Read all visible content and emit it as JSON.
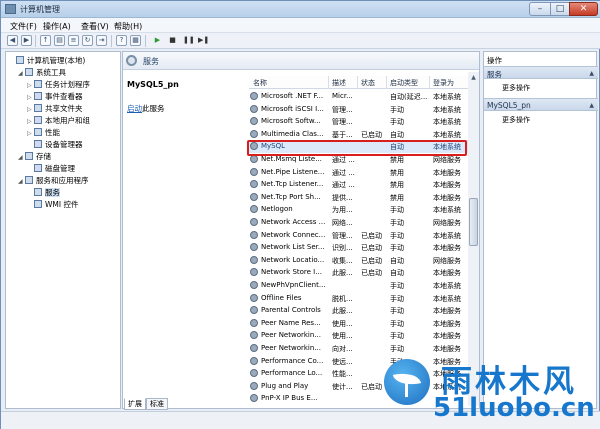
{
  "window": {
    "title": "计算机管理"
  },
  "window_controls": {
    "minimize": "–",
    "maximize": "□",
    "close": "✕"
  },
  "menu": [
    "文件(F)",
    "操作(A)",
    "查看(V)",
    "帮助(H)"
  ],
  "tree": [
    {
      "label": "计算机管理(本地)",
      "exp": "",
      "level": 0,
      "icon": "computer-icon"
    },
    {
      "label": "系统工具",
      "exp": "◢",
      "level": 1,
      "icon": "tools-icon"
    },
    {
      "label": "任务计划程序",
      "exp": "▷",
      "level": 2,
      "icon": "task-scheduler-icon"
    },
    {
      "label": "事件查看器",
      "exp": "▷",
      "level": 2,
      "icon": "event-viewer-icon"
    },
    {
      "label": "共享文件夹",
      "exp": "▷",
      "level": 2,
      "icon": "shared-folder-icon"
    },
    {
      "label": "本地用户和组",
      "exp": "▷",
      "level": 2,
      "icon": "users-icon"
    },
    {
      "label": "性能",
      "exp": "▷",
      "level": 2,
      "icon": "performance-icon"
    },
    {
      "label": "设备管理器",
      "exp": "",
      "level": 2,
      "icon": "device-manager-icon"
    },
    {
      "label": "存储",
      "exp": "◢",
      "level": 1,
      "icon": "storage-icon"
    },
    {
      "label": "磁盘管理",
      "exp": "",
      "level": 2,
      "icon": "disk-icon"
    },
    {
      "label": "服务和应用程序",
      "exp": "◢",
      "level": 1,
      "icon": "services-apps-icon"
    },
    {
      "label": "服务",
      "exp": "",
      "level": 2,
      "icon": "services-icon",
      "selected": true
    },
    {
      "label": "WMI 控件",
      "exp": "",
      "level": 2,
      "icon": "wmi-icon"
    }
  ],
  "middle": {
    "header": "服务",
    "selected_service": "MySQL5_pn",
    "start_link": "启动",
    "start_suffix": "此服务"
  },
  "table": {
    "columns": [
      "名称",
      "描述",
      "状态",
      "启动类型",
      "登录为"
    ],
    "rows": [
      [
        "Microsoft .NET F...",
        "Micr...",
        "",
        "自动(延迟...",
        "本地系统"
      ],
      [
        "Microsoft iSCSI I...",
        "管理...",
        "",
        "手动",
        "本地系统"
      ],
      [
        "Microsoft Softw...",
        "管理...",
        "",
        "手动",
        "本地系统"
      ],
      [
        "Multimedia Clas...",
        "基于...",
        "已启动",
        "自动",
        "本地系统"
      ],
      [
        "MySQL",
        "",
        "",
        "自动",
        "本地系统"
      ],
      [
        "Net.Msmq Liste...",
        "通过 ...",
        "",
        "禁用",
        "网络服务"
      ],
      [
        "Net.Pipe Listene...",
        "通过 ...",
        "",
        "禁用",
        "本地服务"
      ],
      [
        "Net.Tcp Listener...",
        "通过 ...",
        "",
        "禁用",
        "本地服务"
      ],
      [
        "Net.Tcp Port Sh...",
        "提供...",
        "",
        "禁用",
        "本地服务"
      ],
      [
        "Netlogon",
        "为用...",
        "",
        "手动",
        "本地系统"
      ],
      [
        "Network Access ...",
        "网络...",
        "",
        "手动",
        "网络服务"
      ],
      [
        "Network Connec...",
        "管理...",
        "已启动",
        "手动",
        "本地系统"
      ],
      [
        "Network List Ser...",
        "识别...",
        "已启动",
        "手动",
        "本地服务"
      ],
      [
        "Network Locatio...",
        "收集...",
        "已启动",
        "自动",
        "网络服务"
      ],
      [
        "Network Store I...",
        "此服...",
        "已启动",
        "自动",
        "本地服务"
      ],
      [
        "NewPhVpnClient...",
        "",
        "",
        "手动",
        "本地系统"
      ],
      [
        "Offline Files",
        "脱机...",
        "",
        "手动",
        "本地系统"
      ],
      [
        "Parental Controls",
        "此服...",
        "",
        "手动",
        "本地服务"
      ],
      [
        "Peer Name Res...",
        "使用...",
        "",
        "手动",
        "本地服务"
      ],
      [
        "Peer Networkin...",
        "使用...",
        "",
        "手动",
        "本地服务"
      ],
      [
        "Peer Networkin...",
        "向对...",
        "",
        "手动",
        "本地服务"
      ],
      [
        "Performance Co...",
        "使远...",
        "",
        "手动",
        "本地服务"
      ],
      [
        "Performance Lo...",
        "性能...",
        "",
        "手动",
        "本地服务"
      ],
      [
        "Plug and Play",
        "使计...",
        "已启动",
        "自动",
        "本地系统"
      ],
      [
        "PnP-X IP Bus E...",
        "",
        "",
        "",
        ""
      ]
    ],
    "selected_index": 4
  },
  "tabs": [
    "扩展",
    "标准"
  ],
  "actions": {
    "title": "操作",
    "groups": [
      {
        "label": "服务",
        "item": "更多操作"
      },
      {
        "label": "MySQL5_pn",
        "item": "更多操作"
      }
    ]
  },
  "watermark": {
    "cn": "雨林木风",
    "en": "51luobo.cn"
  }
}
